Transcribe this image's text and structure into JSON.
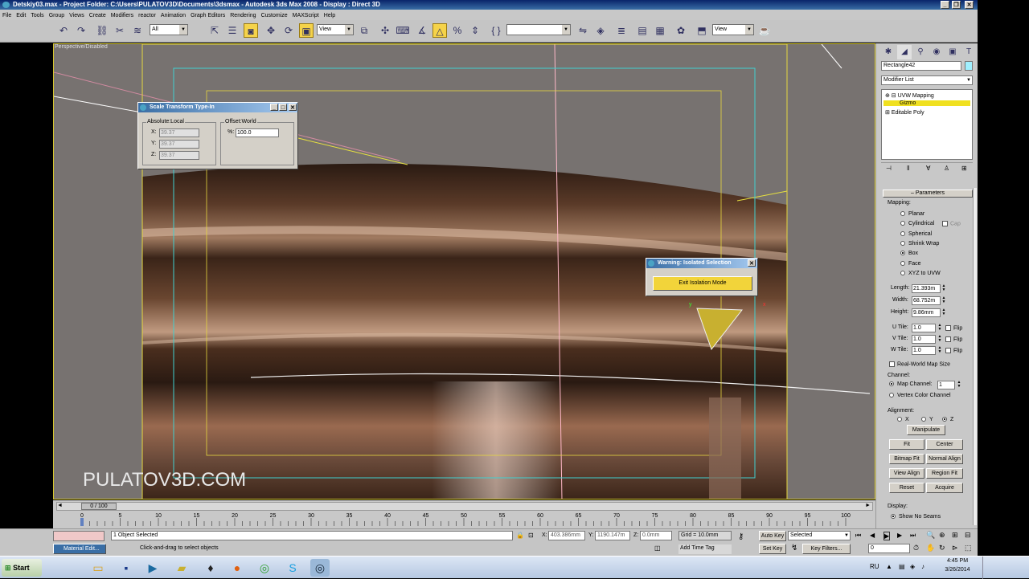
{
  "window": {
    "title": "Detskiy03.max    - Project Folder: C:\\Users\\PULATOV3D\\Documents\\3dsmax    - Autodesk 3ds Max 2008    - Display : Direct 3D",
    "minimize": "_",
    "restore": "❐",
    "close": "✕"
  },
  "menu": [
    "File",
    "Edit",
    "Tools",
    "Group",
    "Views",
    "Create",
    "Modifiers",
    "reactor",
    "Animation",
    "Graph Editors",
    "Rendering",
    "Customize",
    "MAXScript",
    "Help"
  ],
  "toolbar": {
    "selection_filter": "All",
    "coord_system": "View",
    "named_view": "View"
  },
  "viewport": {
    "label": "Perspective/Disabled",
    "watermark": "PULATOV3D.COM"
  },
  "scale_dialog": {
    "title": "Scale Transform Type-In",
    "absolute_label": "Absolute:Local",
    "offset_label": "Offset:World",
    "x_label": "X:",
    "x_value": "39.37",
    "y_label": "Y:",
    "y_value": "39.37",
    "z_label": "Z:",
    "z_value": "39.37",
    "pct_label": "%:",
    "pct_value": "100.0"
  },
  "warning": {
    "title": "Warning: Isolated Selection",
    "button": "Exit Isolation Mode"
  },
  "command_panel": {
    "object_name": "Rectangle42",
    "modifier_list": "Modifier List",
    "stack": [
      {
        "label": "UVW Mapping",
        "type": "modifier"
      },
      {
        "label": "Gizmo",
        "type": "sub"
      },
      {
        "label": "Editable Poly",
        "type": "base"
      }
    ],
    "rollout": "Parameters",
    "mapping_label": "Mapping:",
    "mapping": [
      {
        "label": "Planar",
        "on": false
      },
      {
        "label": "Cylindrical",
        "on": false
      },
      {
        "label": "Spherical",
        "on": false
      },
      {
        "label": "Shrink Wrap",
        "on": false
      },
      {
        "label": "Box",
        "on": true
      },
      {
        "label": "Face",
        "on": false
      },
      {
        "label": "XYZ to UVW",
        "on": false
      }
    ],
    "cap_label": "Cap",
    "length_label": "Length:",
    "length": "21.393m",
    "width_label": "Width:",
    "width": "68.752m",
    "height_label": "Height:",
    "height": "9.86mm",
    "utile_label": "U Tile:",
    "utile": "1.0",
    "vtile_label": "V Tile:",
    "vtile": "1.0",
    "wtile_label": "W Tile:",
    "wtile": "1.0",
    "flip": "Flip",
    "real_world": "Real-World Map Size",
    "channel_label": "Channel:",
    "map_channel_label": "Map Channel:",
    "map_channel": "1",
    "vertex_color_channel": "Vertex Color Channel",
    "alignment_label": "Alignment:",
    "axis_x": "X",
    "axis_y": "Y",
    "axis_z": "Z",
    "buttons": {
      "manipulate": "Manipulate",
      "fit": "Fit",
      "center": "Center",
      "bitmap_fit": "Bitmap Fit",
      "normal_align": "Normal Align",
      "view_align": "View Align",
      "region_fit": "Region Fit",
      "reset": "Reset",
      "acquire": "Acquire"
    },
    "display_label": "Display:",
    "show_no_seams": "Show No Seams"
  },
  "timeline": {
    "frame": "0 / 100",
    "ticks": [
      "0",
      "5",
      "10",
      "15",
      "20",
      "25",
      "30",
      "35",
      "40",
      "45",
      "50",
      "55",
      "60",
      "65",
      "70",
      "75",
      "80",
      "85",
      "90",
      "95",
      "100"
    ]
  },
  "status": {
    "selected": "1 Object Selected",
    "prompt": "Click-and-drag to select objects",
    "x_label": "X:",
    "x": "403.386mm",
    "y_label": "Y:",
    "y": "1190.147m",
    "z_label": "Z:",
    "z": "0.0mm",
    "grid": "Grid = 10.0mm",
    "add_time_tag": "Add Time Tag",
    "auto_key": "Auto Key",
    "set_key": "Set Key",
    "key_mode": "Selected",
    "key_filters": "Key Filters...",
    "frame_field": "0",
    "material_editor": "Material Edit..."
  },
  "taskbar": {
    "start": "Start",
    "lang": "RU",
    "time": "4:45 PM",
    "date": "3/26/2014"
  }
}
